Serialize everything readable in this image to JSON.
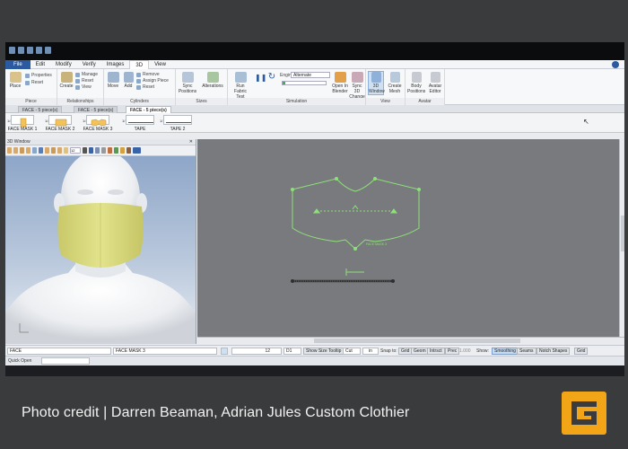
{
  "menu": {
    "items": [
      "File",
      "Edit",
      "Modify",
      "Verify",
      "Images",
      "3D",
      "View"
    ],
    "active": "3D"
  },
  "ribbon": {
    "groups": [
      {
        "label": "Piece"
      },
      {
        "label": "Relationships"
      },
      {
        "label": "Cylinders"
      },
      {
        "label": "Sizes"
      },
      {
        "label": "Simulation"
      },
      {
        "label": "View"
      },
      {
        "label": "Avatar"
      }
    ],
    "buttons": {
      "place": "Place",
      "properties": "Properties",
      "reset": "Reset",
      "create": "Create",
      "manage": "Manage",
      "reset2": "Reset",
      "view": "View",
      "move": "Move",
      "add": "Add",
      "remove": "Remove",
      "assign_piece": "Assign Piece",
      "reset3": "Reset",
      "sync_positions": "Sync Positions",
      "alterations": "Alterations",
      "run_fabric_test": "Run Fabric Test",
      "engine_label": "Engine",
      "engine_value": "Alternate",
      "open_in_blender": "Open In Blender",
      "sync_3d_change": "Sync 3D Change",
      "window_3d": "3D Window",
      "create_mesh": "Create Mesh",
      "body_positions": "Body Positions",
      "avatar_editor": "Avatar Editor"
    }
  },
  "tabs": [
    {
      "label": "FACE - 5 piece(s)",
      "active": false
    },
    {
      "label": "FACE - 5 piece(s)",
      "active": false
    },
    {
      "label": "FACE - 5 piece(s)",
      "active": true
    }
  ],
  "pieces": [
    {
      "label": "FACE MASK 1",
      "num": "1/4"
    },
    {
      "label": "FACE MASK 2",
      "num": "1/4"
    },
    {
      "label": "FACE MASK 3",
      "num": "1/4"
    },
    {
      "label": "TAPE",
      "num": "1/1"
    },
    {
      "label": "TAPE 2",
      "num": "1/1"
    }
  ],
  "window3d": {
    "title": "3D Window",
    "size_value": "12"
  },
  "canvas": {
    "piece_label": "FACE MASK 3"
  },
  "status": {
    "style_field": "FACE",
    "piece_field": "FACE MASK 3",
    "size_value": "12",
    "d1_value": "D1",
    "show_size_tooltip": "Show Size Tooltip",
    "cut_label": "Cut",
    "unit_value": "in",
    "snap_to": "Snap to:",
    "grid": "Grid",
    "geom": "Geom",
    "intrsct": "Intrsct",
    "prec": "Prec",
    "prec_value": "1.000",
    "show": "Show:",
    "smoothing": "Smoothing",
    "seams": "Seams",
    "notch_shapes": "Notch Shapes",
    "grid2": "Grid"
  },
  "quick_open": "Quick Open",
  "credit": "Photo credit | Darren Beaman, Adrian Jules Custom Clothier",
  "colors": {
    "pattern_line": "#8ee07a",
    "mask": "#dfe086",
    "accent": "#2c5aa0",
    "logo": "#f2a516"
  }
}
